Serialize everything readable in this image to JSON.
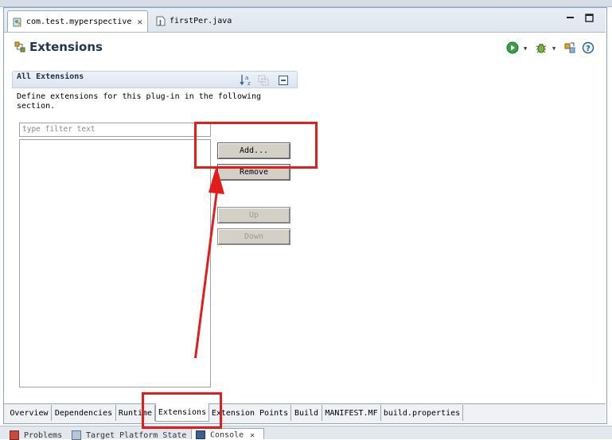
{
  "editor_tabs": [
    {
      "label": "com.test.myperspective",
      "close": "✕"
    },
    {
      "label": "firstPer.java"
    }
  ],
  "header": {
    "title": "Extensions"
  },
  "section": {
    "title": "All Extensions",
    "description": "Define extensions for this plug-in in the following section."
  },
  "filter": {
    "placeholder": "type filter text"
  },
  "buttons": {
    "add": "Add...",
    "remove": "Remove",
    "up": "Up",
    "down": "Down"
  },
  "bottom_tabs": [
    "Overview",
    "Dependencies",
    "Runtime",
    "Extensions",
    "Extension Points",
    "Build",
    "MANIFEST.MF",
    "build.properties"
  ],
  "lower_tabs": [
    "Problems",
    "Target Platform State",
    "Console"
  ],
  "colors": {
    "annotation": "#e31c1c",
    "title": "#24364e"
  },
  "icons": [
    "plugin-icon",
    "java-file-icon",
    "extensions-icon",
    "run-icon",
    "debug-icon",
    "export-icon",
    "help-icon",
    "sort-az-icon",
    "collapse-icon",
    "minimize-icon",
    "maximize-icon"
  ]
}
